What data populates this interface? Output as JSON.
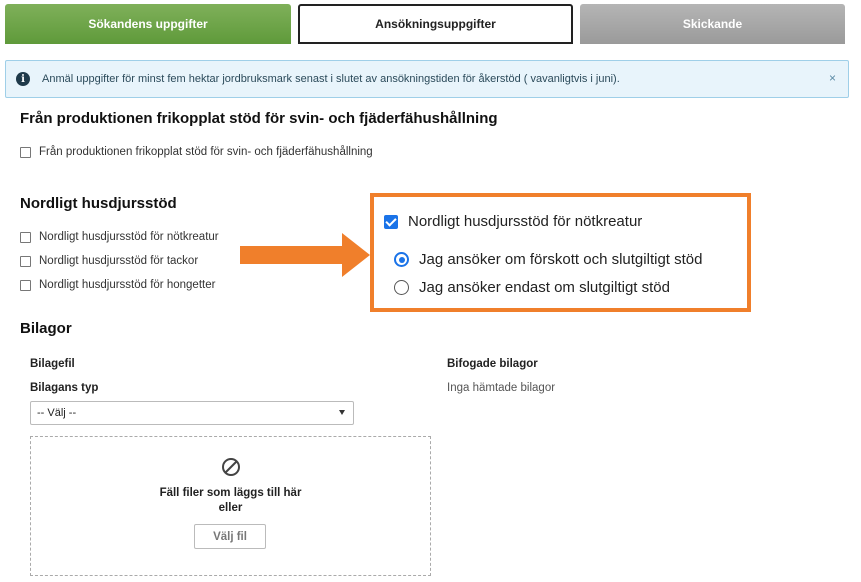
{
  "steps": {
    "step1": "Sökandens uppgifter",
    "step2": "Ansökningsuppgifter",
    "step3": "Skickande"
  },
  "alert": {
    "icon": "info-icon",
    "text": "Anmäl uppgifter för minst fem hektar jordbruksmark senast i slutet av ansökningstiden för åkerstöd ( vavanligtvis i juni).",
    "close": "×"
  },
  "section_pig": {
    "heading": "Från produktionen frikopplat stöd för svin- och fjäderfähushållning",
    "checkbox_label": "Från produktionen frikopplat stöd för svin- och fjäderfähushållning"
  },
  "section_north": {
    "heading": "Nordligt husdjursstöd",
    "options": [
      "Nordligt husdjursstöd för nötkreatur",
      "Nordligt husdjursstöd för tackor",
      "Nordligt husdjursstöd för hongetter"
    ]
  },
  "callout": {
    "checkbox_label": "Nordligt husdjursstöd för nötkreatur",
    "radio1": "Jag ansöker om förskott och slutgiltigt stöd",
    "radio2": "Jag ansöker endast om slutgiltigt stöd",
    "border_color": "#f07f2b"
  },
  "attachments": {
    "heading": "Bilagor",
    "file_label": "Bilagefil",
    "type_label": "Bilagans typ",
    "select_value": "-- Välj --",
    "attached_label": "Bifogade bilagor",
    "attached_empty": "Inga hämtade bilagor",
    "dropzone_line1": "Fäll filer som läggs till här",
    "dropzone_line2": "eller",
    "choose_file": "Välj fil"
  },
  "colors": {
    "step_active": "#6aa444",
    "step_inactive": "#a8a8a8",
    "accent": "#1a73e8",
    "arrow": "#f07f2b"
  }
}
